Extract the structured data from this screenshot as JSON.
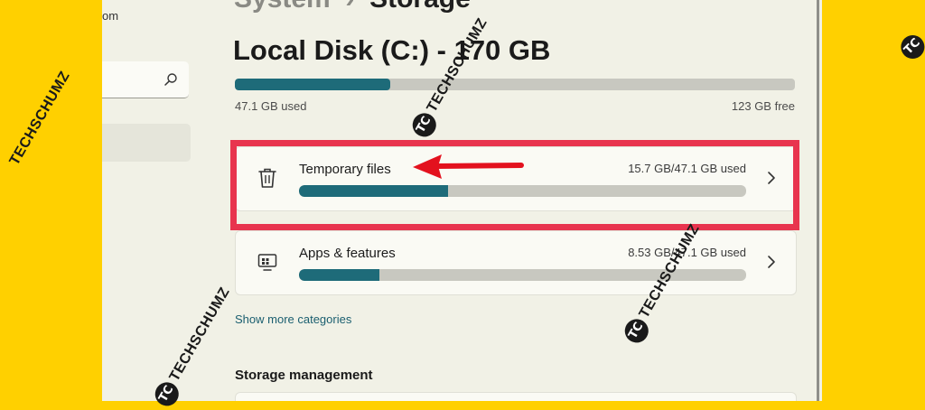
{
  "left_pane": {
    "account_text": "om",
    "search_placeholder": ""
  },
  "breadcrumb": {
    "parent": "System",
    "separator": "›",
    "current": "Storage"
  },
  "disk": {
    "title": "Local Disk (C:) - 170 GB",
    "used_label": "47.1 GB used",
    "free_label": "123 GB free",
    "used_fraction": 0.277
  },
  "categories": [
    {
      "title": "Temporary files",
      "usage": "15.7 GB/47.1 GB used",
      "fraction": 0.333,
      "icon": "trash-icon"
    },
    {
      "title": "Apps & features",
      "usage": "8.53 GB/47.1 GB used",
      "fraction": 0.18,
      "icon": "apps-icon"
    }
  ],
  "show_more": "Show more categories",
  "storage_management": "Storage management",
  "watermark": {
    "badge": "TC",
    "text": "TECHSCHUMZ"
  },
  "colors": {
    "bar_fill": "#1E6B79",
    "bar_track": "#C8C8C0",
    "highlight": "#E8344E",
    "background": "#FFD000",
    "link": "#1A5E6F"
  }
}
